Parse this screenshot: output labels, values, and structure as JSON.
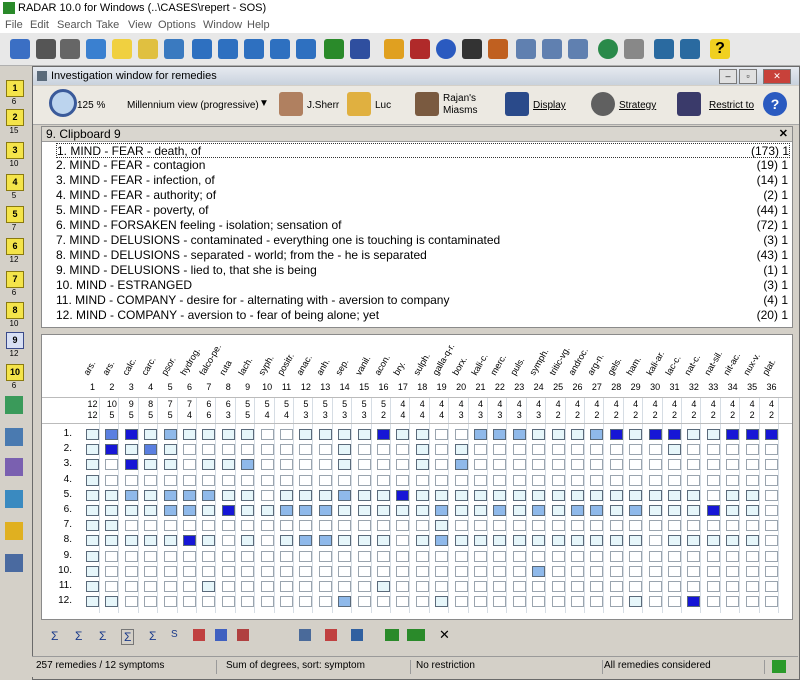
{
  "window": {
    "title": "RADAR 10.0 for Windows  (..\\CASES\\repert - SOS)"
  },
  "menu": [
    "File",
    "Edit",
    "Search",
    "Take",
    "View",
    "Options",
    "Window",
    "Help"
  ],
  "left_clipboards": [
    {
      "label": "1",
      "num": "6"
    },
    {
      "label": "2",
      "num": "15"
    },
    {
      "label": "3",
      "num": "10"
    },
    {
      "label": "4",
      "num": "5"
    },
    {
      "label": "5",
      "num": "7"
    },
    {
      "label": "6",
      "num": "12"
    },
    {
      "label": "7",
      "num": "6"
    },
    {
      "label": "8",
      "num": "10"
    },
    {
      "label": "9",
      "num": "12"
    },
    {
      "label": "10",
      "num": "6"
    }
  ],
  "inv": {
    "title": "Investigation window for remedies",
    "zoom": "125 %",
    "view": "Millennium view (progressive)",
    "user1": "J.Sherr",
    "user2": "Luc",
    "user3_l1": "Rajan's",
    "user3_l2": "Miasms",
    "display": "Display",
    "strategy": "Strategy",
    "restrict": "Restrict to"
  },
  "clipboard": {
    "header": "9.   Clipboard 9",
    "rubrics": [
      {
        "text": "1. MIND - FEAR - death, of",
        "right": "(173) 1"
      },
      {
        "text": "2. MIND - FEAR - contagion",
        "right": "(19) 1"
      },
      {
        "text": "3. MIND - FEAR - infection, of",
        "right": "(14) 1"
      },
      {
        "text": "4. MIND - FEAR - authority; of",
        "right": "(2) 1"
      },
      {
        "text": "5. MIND - FEAR - poverty, of",
        "right": "(44) 1"
      },
      {
        "text": "6. MIND - FORSAKEN feeling - isolation; sensation of",
        "right": "(72) 1"
      },
      {
        "text": "7. MIND - DELUSIONS - contaminated - everything one is touching is contaminated",
        "right": "(3) 1"
      },
      {
        "text": "8. MIND - DELUSIONS - separated - world; from the - he is separated",
        "right": "(43) 1"
      },
      {
        "text": "9. MIND - DELUSIONS - lied to, that she is being",
        "right": "(1) 1"
      },
      {
        "text": "10. MIND - ESTRANGED",
        "right": "(3) 1"
      },
      {
        "text": "11. MIND - COMPANY - desire for - alternating with - aversion to company",
        "right": "(4) 1"
      },
      {
        "text": "12. MIND - COMPANY - aversion to - fear of being alone; yet",
        "right": "(20) 1"
      }
    ]
  },
  "grid": {
    "remedies": [
      "ars.",
      "ars.",
      "calc.",
      "carc.",
      "psor.",
      "hydrog.",
      "falco-pe.",
      "ruta",
      "lach.",
      "syph.",
      "positr.",
      "anac.",
      "anh.",
      "sep.",
      "vanil.",
      "acon.",
      "bry.",
      "sulph.",
      "galla-q-r.",
      "borx.",
      "kali-c.",
      "merc.",
      "puls.",
      "symph.",
      "tritic-vg.",
      "androc.",
      "arg-n.",
      "gels.",
      "ham.",
      "kali-ar.",
      "lac-c.",
      "nat-c.",
      "nat-sil.",
      "nit-ac.",
      "nux-v.",
      "plat."
    ],
    "col_numbers": [
      "1",
      "2",
      "3",
      "4",
      "5",
      "6",
      "7",
      "8",
      "9",
      "10",
      "11",
      "12",
      "13",
      "14",
      "15",
      "16",
      "17",
      "18",
      "19",
      "20",
      "21",
      "22",
      "23",
      "24",
      "25",
      "26",
      "27",
      "28",
      "29",
      "30",
      "31",
      "32",
      "33",
      "34",
      "35",
      "36"
    ],
    "sum_row1": [
      "12",
      "10",
      "9",
      "8",
      "7",
      "7",
      "6",
      "6",
      "5",
      "5",
      "5",
      "5",
      "5",
      "5",
      "5",
      "5",
      "4",
      "4",
      "4",
      "4",
      "4",
      "4",
      "4",
      "4",
      "4",
      "4",
      "4",
      "4",
      "4",
      "4",
      "4",
      "4",
      "4",
      "4",
      "4",
      "4"
    ],
    "sum_row2": [
      "12",
      "5",
      "5",
      "5",
      "5",
      "4",
      "6",
      "3",
      "5",
      "4",
      "4",
      "3",
      "3",
      "3",
      "3",
      "2",
      "4",
      "4",
      "4",
      "3",
      "3",
      "3",
      "3",
      "3",
      "2",
      "2",
      "2",
      "2",
      "2",
      "2",
      "2",
      "2",
      "2",
      "2",
      "2",
      "2"
    ],
    "row_labels": [
      "1.",
      "2.",
      "3.",
      "4.",
      "5.",
      "6.",
      "7.",
      "8.",
      "9.",
      "10.",
      "11.",
      "12."
    ],
    "cells": [
      [
        1,
        3,
        4,
        1,
        2,
        1,
        1,
        1,
        1,
        0,
        0,
        1,
        1,
        1,
        1,
        4,
        1,
        1,
        0,
        0,
        2,
        2,
        2,
        1,
        1,
        1,
        2,
        4,
        1,
        4,
        4,
        1,
        1,
        4,
        4,
        4
      ],
      [
        1,
        4,
        1,
        3,
        1,
        0,
        0,
        0,
        0,
        0,
        0,
        0,
        0,
        1,
        0,
        0,
        0,
        1,
        0,
        1,
        0,
        0,
        0,
        0,
        0,
        0,
        0,
        0,
        0,
        0,
        1,
        0,
        0,
        0,
        0,
        0
      ],
      [
        1,
        0,
        4,
        1,
        1,
        0,
        1,
        1,
        2,
        0,
        0,
        0,
        0,
        1,
        0,
        0,
        0,
        1,
        0,
        2,
        0,
        0,
        0,
        0,
        0,
        0,
        0,
        0,
        0,
        0,
        0,
        0,
        0,
        0,
        0,
        0
      ],
      [
        1,
        0,
        0,
        0,
        0,
        0,
        0,
        0,
        0,
        0,
        0,
        0,
        0,
        0,
        0,
        0,
        0,
        0,
        0,
        0,
        0,
        0,
        0,
        0,
        0,
        0,
        0,
        0,
        0,
        0,
        0,
        0,
        0,
        0,
        0,
        0
      ],
      [
        1,
        1,
        2,
        1,
        2,
        2,
        2,
        1,
        1,
        0,
        1,
        1,
        1,
        2,
        1,
        1,
        4,
        1,
        1,
        1,
        1,
        1,
        1,
        1,
        1,
        1,
        1,
        1,
        1,
        1,
        1,
        1,
        0,
        1,
        1,
        0
      ],
      [
        1,
        1,
        1,
        1,
        2,
        2,
        1,
        4,
        1,
        1,
        2,
        2,
        2,
        1,
        1,
        1,
        1,
        1,
        2,
        1,
        1,
        2,
        1,
        2,
        1,
        2,
        2,
        1,
        2,
        1,
        1,
        1,
        4,
        1,
        1,
        0
      ],
      [
        1,
        1,
        0,
        0,
        0,
        0,
        0,
        0,
        0,
        0,
        0,
        0,
        0,
        0,
        0,
        0,
        0,
        0,
        1,
        0,
        0,
        0,
        0,
        0,
        0,
        0,
        0,
        0,
        0,
        0,
        0,
        0,
        0,
        0,
        0,
        0
      ],
      [
        1,
        1,
        1,
        1,
        1,
        4,
        1,
        0,
        1,
        0,
        1,
        2,
        2,
        1,
        1,
        1,
        0,
        1,
        2,
        1,
        1,
        1,
        1,
        1,
        1,
        1,
        1,
        1,
        1,
        0,
        1,
        1,
        1,
        1,
        1,
        0
      ],
      [
        1,
        0,
        0,
        0,
        0,
        0,
        0,
        0,
        0,
        0,
        0,
        0,
        0,
        0,
        0,
        0,
        0,
        0,
        0,
        0,
        0,
        0,
        0,
        0,
        0,
        0,
        0,
        0,
        0,
        0,
        0,
        0,
        0,
        0,
        0,
        0
      ],
      [
        1,
        0,
        0,
        0,
        0,
        0,
        0,
        0,
        0,
        0,
        0,
        0,
        0,
        0,
        0,
        0,
        0,
        0,
        0,
        0,
        0,
        0,
        0,
        2,
        0,
        0,
        0,
        0,
        0,
        0,
        0,
        0,
        0,
        0,
        0,
        0
      ],
      [
        1,
        0,
        0,
        0,
        0,
        0,
        1,
        0,
        0,
        0,
        0,
        0,
        0,
        0,
        0,
        1,
        0,
        0,
        0,
        0,
        0,
        0,
        0,
        0,
        0,
        0,
        0,
        0,
        0,
        0,
        0,
        0,
        0,
        0,
        0,
        0
      ],
      [
        1,
        1,
        0,
        0,
        0,
        0,
        0,
        0,
        0,
        0,
        0,
        0,
        0,
        2,
        0,
        0,
        0,
        0,
        1,
        0,
        0,
        0,
        0,
        0,
        0,
        0,
        0,
        0,
        1,
        0,
        0,
        4,
        0,
        0,
        0,
        0
      ]
    ]
  },
  "status": {
    "left": "257 remedies / 12 symptoms",
    "sort": "Sum of degrees, sort: symptom",
    "restriction": "No restriction",
    "considered": "All remedies considered"
  },
  "colors": {
    "deg1": "#e6f6fa",
    "deg2": "#8fb9ea",
    "deg3": "#5a7fe0",
    "deg4": "#1616d6"
  }
}
